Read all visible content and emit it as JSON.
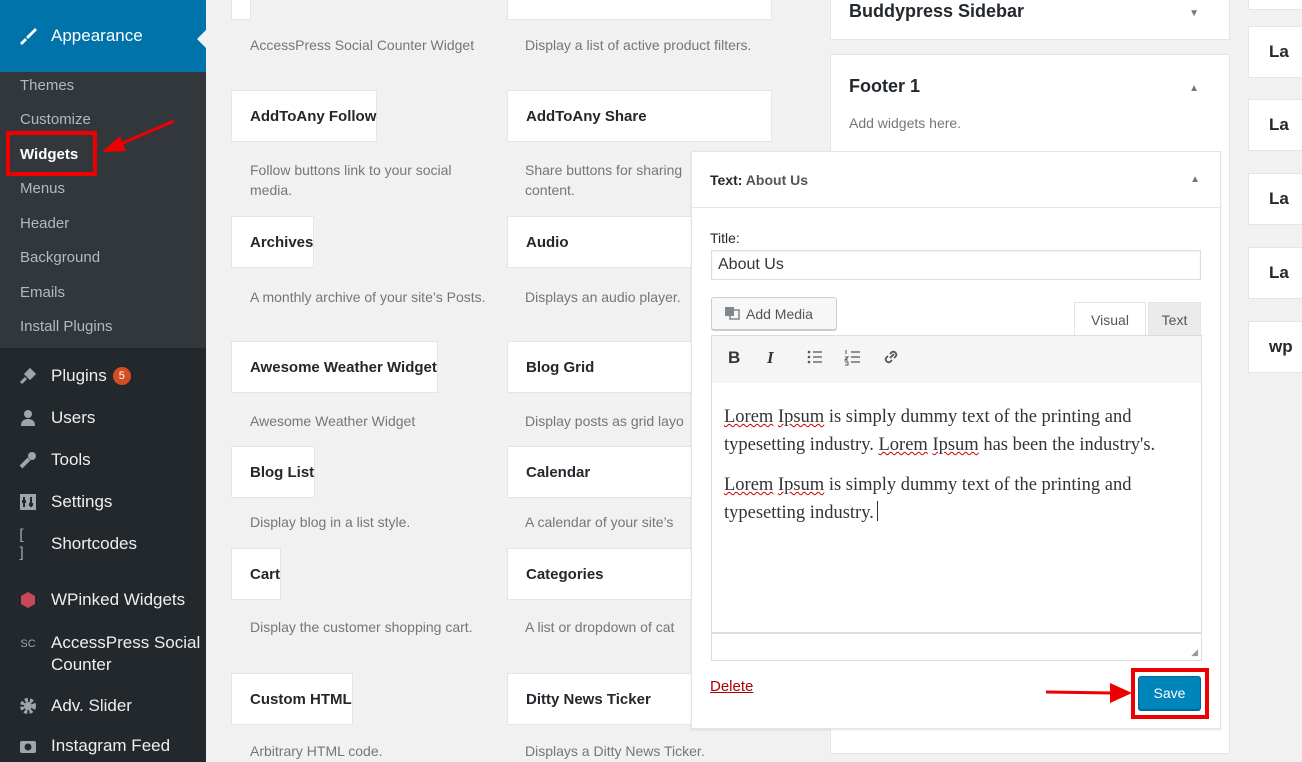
{
  "sidebar": {
    "appearance_label": "Appearance",
    "submenu": [
      "Themes",
      "Customize",
      "Widgets",
      "Menus",
      "Header",
      "Background",
      "Emails",
      "Install Plugins"
    ],
    "menu": [
      {
        "label": "Plugins",
        "badge": "5",
        "icon": "plugin-icon"
      },
      {
        "label": "Users",
        "icon": "users-icon"
      },
      {
        "label": "Tools",
        "icon": "tools-icon"
      },
      {
        "label": "Settings",
        "icon": "settings-icon"
      },
      {
        "label": "Shortcodes",
        "icon": "shortcodes-icon",
        "glyph": "[ ]"
      },
      {
        "label": "WPinked Widgets",
        "icon": "wpinked-icon"
      },
      {
        "label": "AccessPress Social Counter",
        "icon": "sc-icon",
        "glyph": "SC"
      },
      {
        "label": "Adv. Slider",
        "icon": "gear-icon"
      },
      {
        "label": "Instagram Feed",
        "icon": "camera-icon"
      }
    ]
  },
  "widgets_left": {
    "top_desc": "AccessPress Social Counter Widget",
    "items": [
      {
        "title": "AddToAny Follow",
        "desc": "Follow buttons link to your social media."
      },
      {
        "title": "Archives",
        "desc": "A monthly archive of your site’s Posts."
      },
      {
        "title": "Awesome Weather Widget",
        "desc": "Awesome Weather Widget"
      },
      {
        "title": "Blog List",
        "desc": "Display blog in a list style."
      },
      {
        "title": "Cart",
        "desc": "Display the customer shopping cart."
      },
      {
        "title": "Custom HTML",
        "desc": "Arbitrary HTML code."
      }
    ]
  },
  "widgets_right": {
    "top_desc": "Display a list of active product filters.",
    "items": [
      {
        "title": "AddToAny Share",
        "desc": "Share buttons for sharing content."
      },
      {
        "title": "Audio",
        "desc": "Displays an audio player."
      },
      {
        "title": "Blog Grid",
        "desc": "Display posts as grid layo"
      },
      {
        "title": "Calendar",
        "desc": "A calendar of your site’s"
      },
      {
        "title": "Categories",
        "desc": "A list or dropdown of cat"
      },
      {
        "title": "Ditty News Ticker",
        "desc": "Displays a Ditty News Ticker."
      }
    ]
  },
  "areas": {
    "buddypress_title": "Buddypress Sidebar",
    "footer1_title": "Footer 1",
    "footer1_desc": "Add widgets here."
  },
  "text_widget": {
    "header_prefix": "Text:",
    "header_name": "About Us",
    "title_label": "Title:",
    "title_value": "About Us",
    "add_media_label": "Add Media",
    "tab_visual": "Visual",
    "tab_text": "Text",
    "paragraph1": [
      "Lorem",
      " ",
      "Ipsum",
      " is simply dummy text of the printing and typesetting industry. ",
      "Lorem",
      " ",
      "Ipsum",
      " has been the industry's."
    ],
    "paragraph2": [
      "Lorem",
      " ",
      "Ipsum",
      " is simply dummy text of the printing and typesetting industry."
    ],
    "delete_label": "Delete",
    "save_label": "Save"
  },
  "right_column": [
    "La",
    "La",
    "La",
    "La",
    "wp"
  ],
  "colors": {
    "sidebar_bg": "#23282d",
    "submenu_bg": "#32373c",
    "accent": "#0073aa",
    "button_primary": "#0085ba",
    "annotation_red": "#ee0000",
    "badge": "#d54e21"
  }
}
